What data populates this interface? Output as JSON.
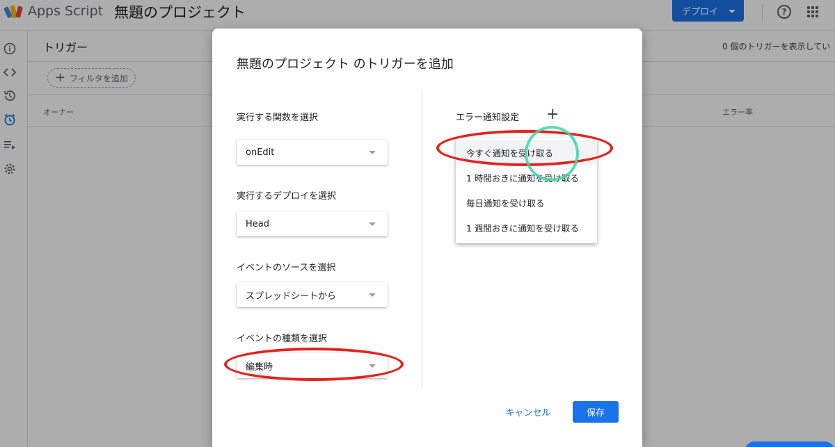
{
  "app": {
    "name": "Apps Script",
    "project_title": "無題のプロジェクト",
    "deploy_label": "デプロイ",
    "help_glyph": "?"
  },
  "sidebar": {
    "items": [
      {
        "icon": "info-icon"
      },
      {
        "icon": "code-icon"
      },
      {
        "icon": "history-icon"
      },
      {
        "icon": "alarm-clock-icon",
        "active": true
      },
      {
        "icon": "executions-icon"
      },
      {
        "icon": "settings-icon"
      }
    ]
  },
  "triggers_page": {
    "title": "トリガー",
    "count_text": "0 個のトリガーを表示してい",
    "filter_label": "フィルタを追加",
    "columns": [
      "オーナー",
      "エラー率"
    ]
  },
  "dialog": {
    "title": "無題のプロジェクト のトリガーを追加",
    "function_label": "実行する関数を選択",
    "function_value": "onEdit",
    "deployment_label": "実行するデプロイを選択",
    "deployment_value": "Head",
    "event_source_label": "イベントのソースを選択",
    "event_source_value": "スプレッドシートから",
    "event_type_label": "イベントの種類を選択",
    "event_type_value": "編集時",
    "error_notification_label": "エラー通知設定",
    "error_options": [
      "今すぐ通知を受け取る",
      "1 時間おきに通知を受け取る",
      "毎日通知を受け取る",
      "1 週間おきに通知を受け取る"
    ],
    "cancel_label": "キャンセル",
    "save_label": "保存"
  },
  "colors": {
    "accent": "#1a73e8",
    "annotation_red": "#e3221c",
    "annotation_green": "#3fd4a8"
  }
}
